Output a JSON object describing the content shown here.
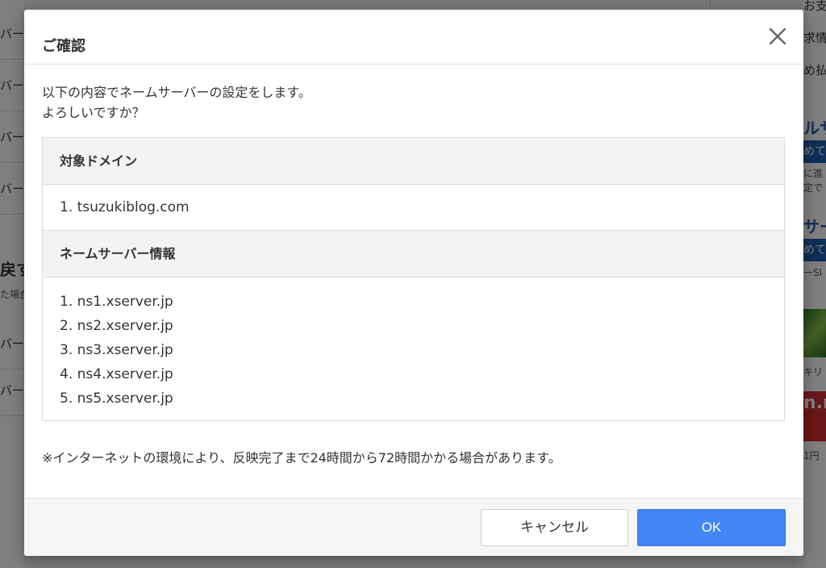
{
  "background": {
    "left_items": [
      "バー",
      "バー",
      "バー",
      "バー",
      "バー",
      "バー"
    ],
    "left_heading": "戻す",
    "left_sub": "た場合",
    "right_texts": [
      "お支払情",
      "求情",
      "め払"
    ],
    "right_blue_1": "ルサ",
    "right_badge_1": "めて",
    "right_small_1": "に進",
    "right_small_2": "定で",
    "right_blue_2": "サー",
    "right_badge_2": "めて",
    "right_small_3": "ーSI",
    "right_small_4": "キリ",
    "right_red": "n.r or",
    "right_small_5": "1円"
  },
  "modal": {
    "title": "ご確認",
    "close_label": "×",
    "intro_line1": "以下の内容でネームサーバーの設定をします。",
    "intro_line2": "よろしいですか？",
    "domain_header": "対象ドメイン",
    "domains": [
      "1. tsuzukiblog.com"
    ],
    "ns_header": "ネームサーバー情報",
    "nameservers": [
      "1. ns1.xserver.jp",
      "2. ns2.xserver.jp",
      "3. ns3.xserver.jp",
      "4. ns4.xserver.jp",
      "5. ns5.xserver.jp"
    ],
    "note": "※インターネットの環境により、反映完了まで24時間から72時間かかる場合があります。",
    "cancel_label": "キャンセル",
    "ok_label": "OK"
  },
  "colors": {
    "ok_button": "#4285f4",
    "overlay": "rgba(0,0,0,0.5)",
    "table_header_bg": "#f3f3f3"
  }
}
